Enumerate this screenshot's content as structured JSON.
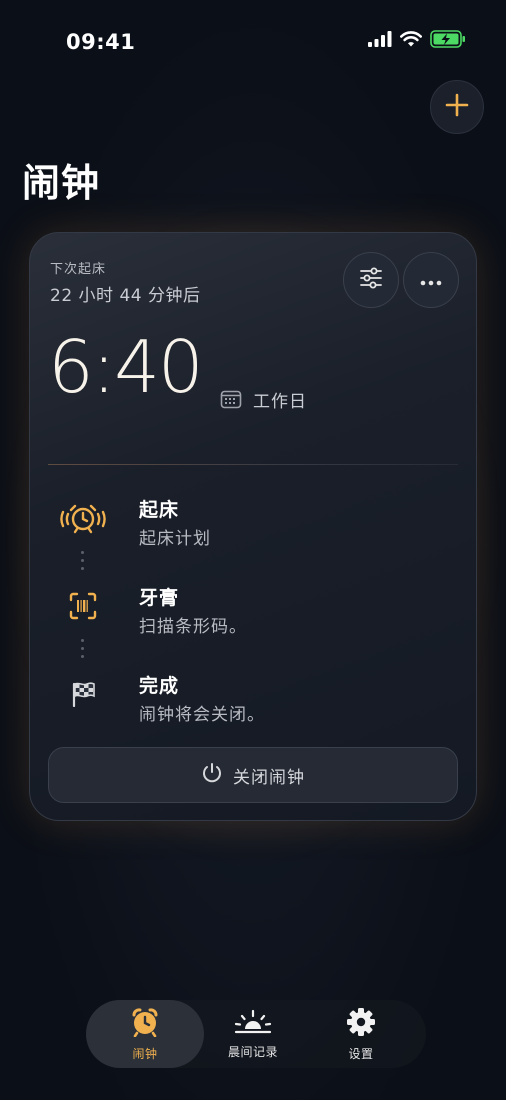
{
  "status_bar": {
    "time": "09:41"
  },
  "header": {
    "title": "闹钟",
    "add_icon": "plus-icon"
  },
  "alarm_card": {
    "next_label": "下次起床",
    "countdown": "22 小时 44 分钟后",
    "time": "6:40",
    "repeat": "工作日",
    "steps": [
      {
        "icon": "alarm-ringing-icon",
        "title": "起床",
        "subtitle": "起床计划"
      },
      {
        "icon": "barcode-scan-icon",
        "title": "牙膏",
        "subtitle": "扫描条形码。"
      },
      {
        "icon": "checkered-flag-icon",
        "title": "完成",
        "subtitle": "闹钟将会关闭。"
      }
    ],
    "dismiss_label": "关闭闹钟"
  },
  "tab_bar": {
    "tabs": [
      {
        "label": "闹钟",
        "icon": "alarm-clock-icon",
        "active": true
      },
      {
        "label": "晨间记录",
        "icon": "sunrise-icon",
        "active": false
      },
      {
        "label": "设置",
        "icon": "gear-icon",
        "active": false
      }
    ]
  },
  "colors": {
    "accent": "#F1B14F",
    "background": "#0B0F17",
    "card": "#1A1F29",
    "battery": "#4CD964"
  }
}
